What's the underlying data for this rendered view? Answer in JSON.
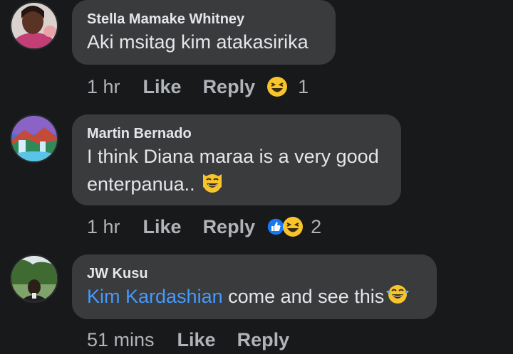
{
  "comments": [
    {
      "author": "Stella Mamake Whitney",
      "text": "Aki msitag kim atakasirika",
      "time": "1 hr",
      "like_label": "Like",
      "reply_label": "Reply",
      "reaction_count": "1",
      "reactions": [
        "laughing-face-icon"
      ]
    },
    {
      "author": "Martin Bernado",
      "text_line1": "I think Diana maraa is a very good",
      "text_line2": "enterpanua..",
      "time": "1 hr",
      "like_label": "Like",
      "reply_label": "Reply",
      "reaction_count": "2",
      "reactions": [
        "like-thumb-icon",
        "laughing-face-icon"
      ]
    },
    {
      "author": "JW Kusu",
      "mention": "Kim Kardashian",
      "text": " come and see this",
      "time": "51 mins",
      "like_label": "Like",
      "reply_label": "Reply"
    }
  ],
  "colors": {
    "background": "#18191a",
    "bubble": "#3a3b3c",
    "primary_text": "#e4e6eb",
    "secondary_text": "#b0b3b8",
    "mention_link": "#4599ff",
    "like_blue": "#1877f2",
    "emoji_yellow": "#f7c52b"
  }
}
